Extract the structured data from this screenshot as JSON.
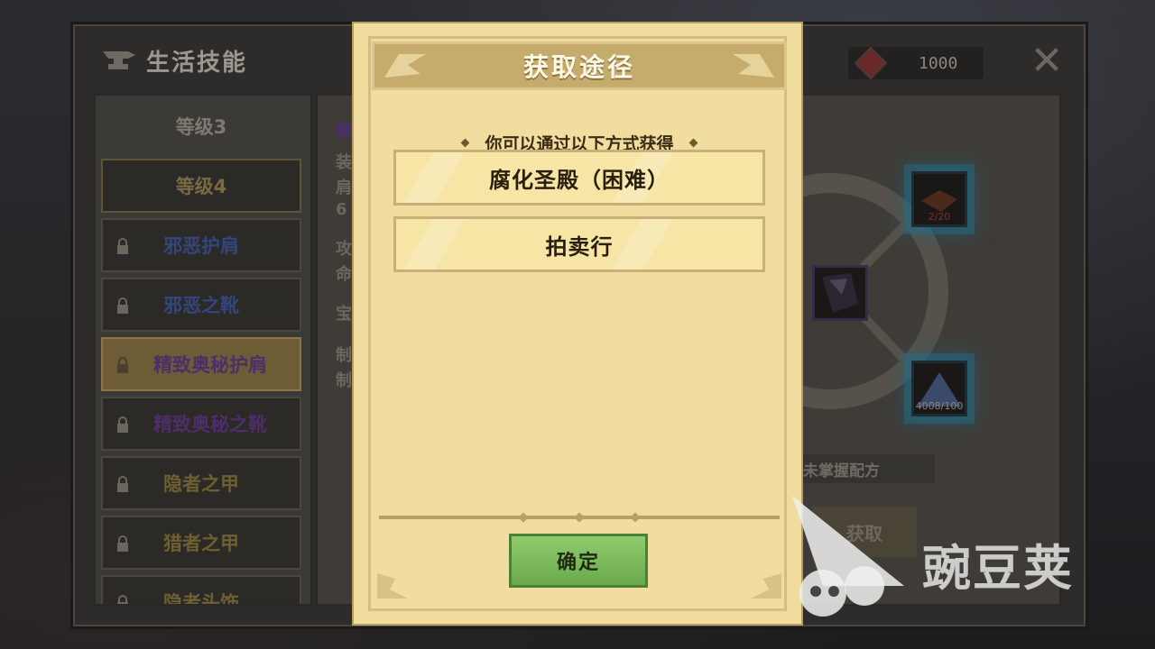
{
  "background": {
    "title": "生活技能",
    "gem_count": "1000",
    "sidebar": [
      {
        "label": "等级3",
        "type": "level"
      },
      {
        "label": "等级4",
        "type": "selected-level"
      },
      {
        "label": "邪恶护肩",
        "type": "item",
        "color": "blue"
      },
      {
        "label": "邪恶之靴",
        "type": "item",
        "color": "blue"
      },
      {
        "label": "精致奥秘护肩",
        "type": "item",
        "color": "purple",
        "active": true
      },
      {
        "label": "精致奥秘之靴",
        "type": "item",
        "color": "purple"
      },
      {
        "label": "隐者之甲",
        "type": "item",
        "color": "gold"
      },
      {
        "label": "猎者之甲",
        "type": "item",
        "color": "gold"
      },
      {
        "label": "隐者头饰",
        "type": "item",
        "color": "gold"
      }
    ],
    "detail_fragments": [
      "精",
      "装",
      "肩",
      "6",
      "攻",
      "命",
      "宝",
      "制",
      "制"
    ],
    "material_1_count": "2/20",
    "material_2_count": "4008/100",
    "unlearned_label": "未掌握配方",
    "get_button_label": "获取"
  },
  "modal": {
    "title": "获取途径",
    "subtitle": "你可以通过以下方式获得",
    "sources": [
      "腐化圣殿（困难）",
      "拍卖行"
    ],
    "confirm_label": "确定"
  },
  "watermark": "豌豆荚",
  "colors": {
    "modal_bg": "#f0dc9c",
    "header_bg": "#c5ac6d",
    "confirm_green": "#7bbb5c",
    "purple_item": "#4e2d6b",
    "blue_item": "#34467e"
  }
}
